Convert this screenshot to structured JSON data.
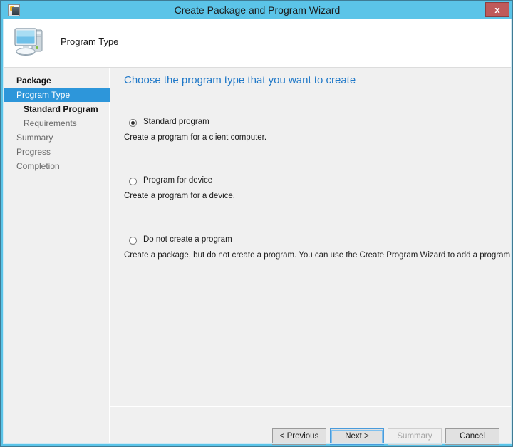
{
  "window": {
    "title": "Create Package and Program Wizard",
    "close_label": "x",
    "titlebar_icon": "package-wizard-icon",
    "accent_color": "#5bc4e8",
    "close_color": "#bf5a5a"
  },
  "header": {
    "title": "Program Type",
    "icon": "computer-monitor-icon"
  },
  "sidebar": {
    "items": [
      {
        "label": "Package",
        "level": 1,
        "state": "completed"
      },
      {
        "label": "Program Type",
        "level": 1,
        "state": "active"
      },
      {
        "label": "Standard Program",
        "level": 2,
        "state": "completed"
      },
      {
        "label": "Requirements",
        "level": 2,
        "state": "muted"
      },
      {
        "label": "Summary",
        "level": 1,
        "state": "muted"
      },
      {
        "label": "Progress",
        "level": 1,
        "state": "muted"
      },
      {
        "label": "Completion",
        "level": 1,
        "state": "muted"
      }
    ],
    "active_color": "#2d96da"
  },
  "main": {
    "heading": "Choose the program type that you want to create",
    "heading_color": "#1f78c8",
    "options": [
      {
        "label": "Standard program",
        "description": "Create a program for a client computer.",
        "selected": true
      },
      {
        "label": "Program for device",
        "description": "Create a program for a device.",
        "selected": false
      },
      {
        "label": "Do not create a program",
        "description": "Create a package, but do not create a program. You can use the Create Program Wizard to add a program later.",
        "selected": false
      }
    ]
  },
  "footer": {
    "buttons": [
      {
        "id": "previous",
        "label": "< Previous",
        "state": "enabled"
      },
      {
        "id": "next",
        "label": "Next >",
        "state": "focused"
      },
      {
        "id": "summary",
        "label": "Summary",
        "state": "disabled"
      },
      {
        "id": "cancel",
        "label": "Cancel",
        "state": "enabled"
      }
    ]
  }
}
